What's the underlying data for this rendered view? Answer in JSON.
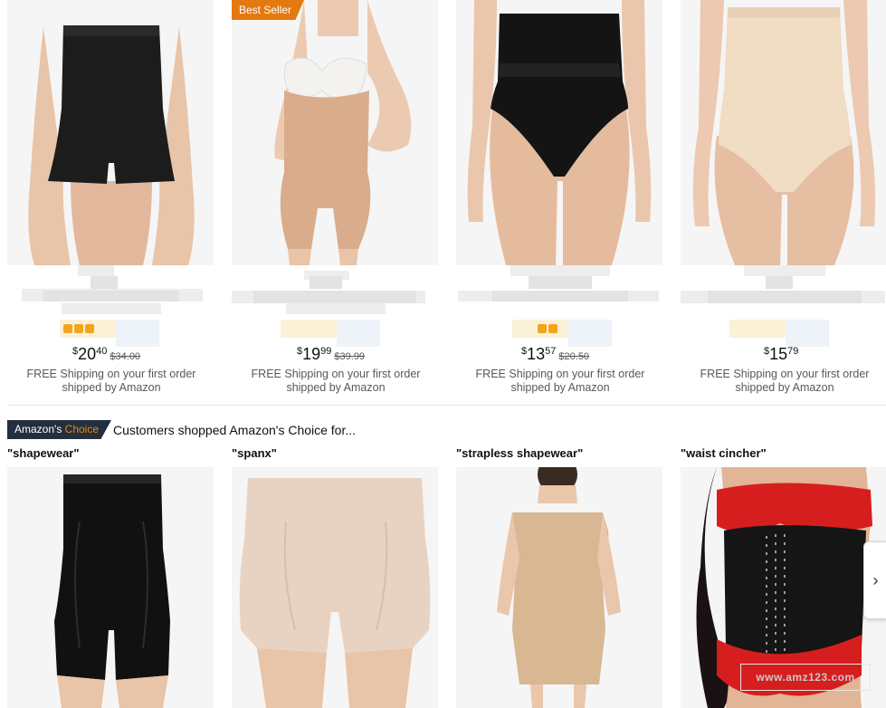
{
  "top_products": [
    {
      "badge": "",
      "price_symbol": "$",
      "price_whole": "20",
      "price_fraction": "40",
      "list_price": "$34.00",
      "shipping": "FREE Shipping on your first order shipped by Amazon",
      "image": "black-high-waist-shaper-shorts"
    },
    {
      "badge": "Best Seller",
      "price_symbol": "$",
      "price_whole": "19",
      "price_fraction": "99",
      "list_price": "$39.99",
      "shipping": "FREE Shipping on your first order shipped by Amazon",
      "image": "nude-open-bust-bodysuit"
    },
    {
      "badge": "",
      "price_symbol": "$",
      "price_whole": "13",
      "price_fraction": "57",
      "list_price": "$20.50",
      "shipping": "FREE Shipping on your first order shipped by Amazon",
      "image": "black-high-waist-brief"
    },
    {
      "badge": "",
      "price_symbol": "$",
      "price_whole": "15",
      "price_fraction": "79",
      "list_price": "",
      "shipping": "FREE Shipping on your first order shipped by Amazon",
      "image": "nude-high-waist-brief"
    }
  ],
  "amazons_choice": {
    "badge_part1": "Amazon's",
    "badge_part2": "Choice",
    "heading": "Customers shopped Amazon's Choice for...",
    "items": [
      {
        "keyword": "\"shapewear\"",
        "image": "black-high-waist-long-shaper"
      },
      {
        "keyword": "\"spanx\"",
        "image": "nude-thigh-shaper"
      },
      {
        "keyword": "\"strapless shapewear\"",
        "image": "nude-strapless-slip"
      },
      {
        "keyword": "\"waist cincher\"",
        "image": "black-red-waist-cincher"
      }
    ]
  },
  "carousel": {
    "next_icon": "chevron-right-icon",
    "next_glyph": "›"
  },
  "watermark": "www.amz123.com",
  "colors": {
    "best_seller": "#e47911",
    "choice_badge": "#232f3e",
    "choice_accent": "#f08804"
  }
}
